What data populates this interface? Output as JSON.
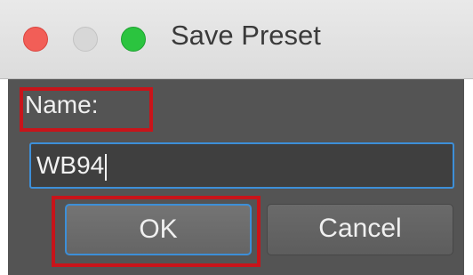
{
  "window": {
    "title": "Save Preset",
    "controls": [
      "close",
      "minimize",
      "zoom"
    ]
  },
  "form": {
    "name_label": "Name:",
    "name_value": "WB94"
  },
  "buttons": {
    "ok_label": "OK",
    "cancel_label": "Cancel"
  },
  "highlights": {
    "color": "#c8141a",
    "targets": [
      "name-label",
      "ok-button"
    ]
  },
  "colors": {
    "close": "#f25e57",
    "minimize": "#d7d7d7",
    "zoom": "#2bc43f",
    "panel": "#545454",
    "focus_ring": "#3d8fd8"
  }
}
